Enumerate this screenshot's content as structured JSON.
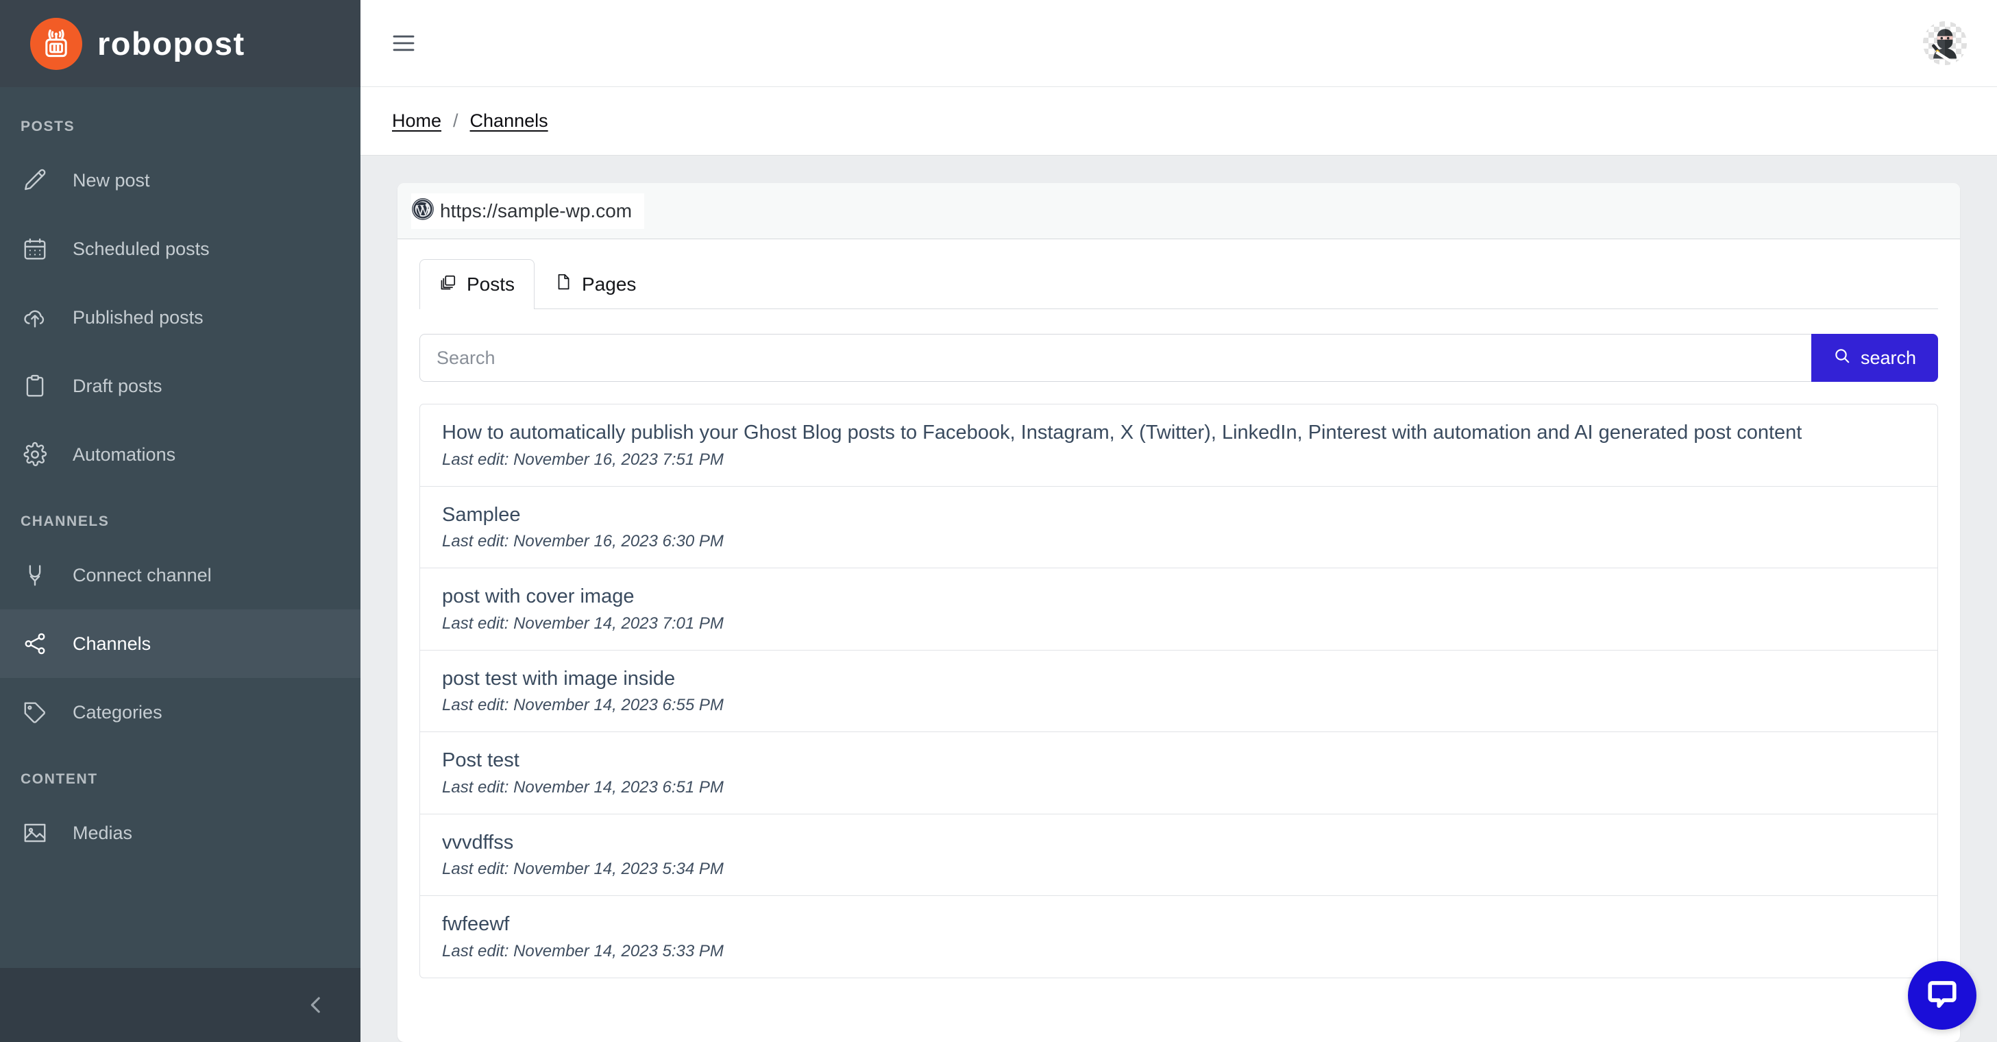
{
  "brand": {
    "name": "robopost",
    "logo_icon": "robot-radio-icon",
    "accent_color": "#f25c26"
  },
  "sidebar": {
    "sections": [
      {
        "label": "POSTS",
        "items": [
          {
            "label": "New post",
            "icon": "pencil-icon",
            "active": false
          },
          {
            "label": "Scheduled posts",
            "icon": "calendar-icon",
            "active": false
          },
          {
            "label": "Published posts",
            "icon": "cloud-upload-icon",
            "active": false
          },
          {
            "label": "Draft posts",
            "icon": "clipboard-icon",
            "active": false
          },
          {
            "label": "Automations",
            "icon": "gear-icon",
            "active": false
          }
        ]
      },
      {
        "label": "CHANNELS",
        "items": [
          {
            "label": "Connect channel",
            "icon": "plug-icon",
            "active": false
          },
          {
            "label": "Channels",
            "icon": "share-nodes-icon",
            "active": true
          },
          {
            "label": "Categories",
            "icon": "tag-icon",
            "active": false
          }
        ]
      },
      {
        "label": "CONTENT",
        "items": [
          {
            "label": "Medias",
            "icon": "image-icon",
            "active": false
          }
        ]
      }
    ],
    "collapse_icon": "chevron-left-icon"
  },
  "topbar": {
    "menu_icon": "hamburger-icon",
    "avatar_icon": "ninja-avatar"
  },
  "breadcrumb": {
    "items": [
      "Home",
      "Channels"
    ],
    "separator": "/"
  },
  "channel": {
    "platform_icon": "wordpress-icon",
    "url": "https://sample-wp.com"
  },
  "tabs": [
    {
      "label": "Posts",
      "icon": "copy-icon",
      "active": true
    },
    {
      "label": "Pages",
      "icon": "file-icon",
      "active": false
    }
  ],
  "search": {
    "placeholder": "Search",
    "value": "",
    "button_label": "search",
    "button_icon": "search-icon",
    "button_color": "#3322d6"
  },
  "posts": [
    {
      "title": "How to automatically publish your Ghost Blog posts to Facebook, Instagram, X (Twitter), LinkedIn, Pinterest with automation and AI generated post content",
      "meta": "Last edit: November 16, 2023 7:51 PM"
    },
    {
      "title": "Samplee",
      "meta": "Last edit: November 16, 2023 6:30 PM"
    },
    {
      "title": "post with cover image",
      "meta": "Last edit: November 14, 2023 7:01 PM"
    },
    {
      "title": "post test with image inside",
      "meta": "Last edit: November 14, 2023 6:55 PM"
    },
    {
      "title": "Post test",
      "meta": "Last edit: November 14, 2023 6:51 PM"
    },
    {
      "title": "vvvdffss",
      "meta": "Last edit: November 14, 2023 5:34 PM"
    },
    {
      "title": "fwfeewf",
      "meta": "Last edit: November 14, 2023 5:33 PM"
    }
  ],
  "chat_widget": {
    "icon": "chat-bubble-icon",
    "color": "#1a0ed8"
  }
}
